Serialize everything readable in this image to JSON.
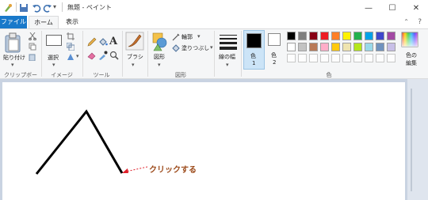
{
  "window": {
    "title": "無題 - ペイント",
    "controls": {
      "minimize": "—",
      "maximize": "☐",
      "close": "✕"
    }
  },
  "tabs": [
    {
      "label": "ファイル"
    },
    {
      "label": "ホーム"
    },
    {
      "label": "表示"
    }
  ],
  "ribbon": {
    "clipboard": {
      "paste_label": "貼り付け",
      "group_label": "クリップボード"
    },
    "image": {
      "select_label": "選択",
      "group_label": "イメージ"
    },
    "tools": {
      "group_label": "ツール"
    },
    "brushes": {
      "label": "ブラシ"
    },
    "shapes": {
      "shapes_label": "図形",
      "outline_label": "輪郭",
      "fill_label": "塗りつぶし",
      "group_label": "図形"
    },
    "size": {
      "label": "線の幅"
    },
    "color1": {
      "label": "色",
      "num": "1"
    },
    "color2": {
      "label": "色",
      "num": "2"
    },
    "colors": {
      "group_label": "色",
      "edit_label": "色の編集"
    },
    "palette_row1": [
      "#000000",
      "#7f7f7f",
      "#880015",
      "#ed1c24",
      "#ff7f27",
      "#fff200",
      "#22b14c",
      "#00a2e8",
      "#3f48cc",
      "#a349a4"
    ],
    "palette_row2": [
      "#ffffff",
      "#c3c3c3",
      "#b97a57",
      "#ffaec9",
      "#ffc90e",
      "#efe4b0",
      "#b5e61d",
      "#99d9ea",
      "#7092be",
      "#c8bfe7"
    ]
  },
  "canvas": {
    "annotation": "クリックする"
  }
}
